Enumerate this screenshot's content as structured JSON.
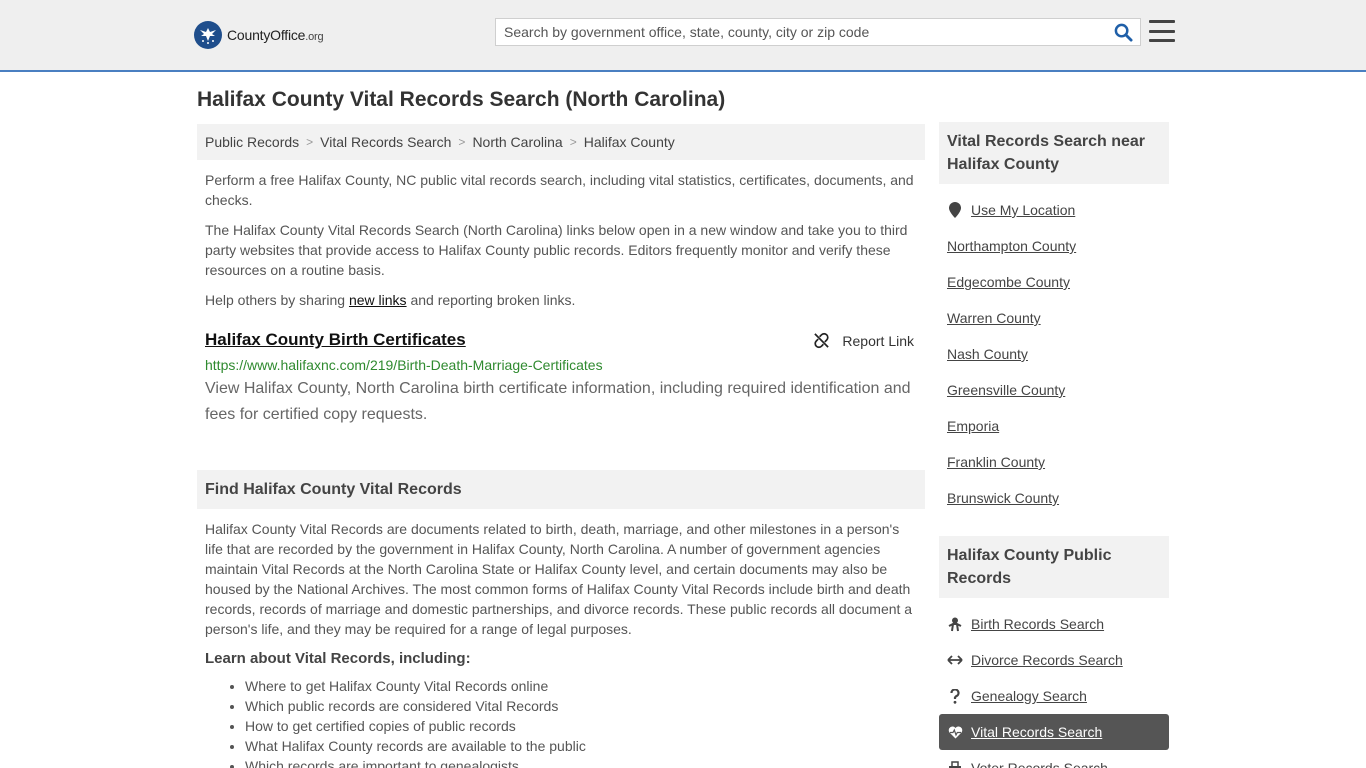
{
  "header": {
    "logo_main": "CountyOffice",
    "logo_tld": ".org",
    "search_placeholder": "Search by government office, state, county, city or zip code"
  },
  "page_title": "Halifax County Vital Records Search (North Carolina)",
  "breadcrumb": [
    "Public Records",
    "Vital Records Search",
    "North Carolina",
    "Halifax County"
  ],
  "intro": {
    "p1": "Perform a free Halifax County, NC public vital records search, including vital statistics, certificates, documents, and checks.",
    "p2": "The Halifax County Vital Records Search (North Carolina) links below open in a new window and take you to third party websites that provide access to Halifax County public records. Editors frequently monitor and verify these resources on a routine basis.",
    "p3_before": "Help others by sharing ",
    "p3_link": "new links",
    "p3_after": " and reporting broken links."
  },
  "result": {
    "title": "Halifax County Birth Certificates",
    "report_label": "Report Link",
    "url": "https://www.halifaxnc.com/219/Birth-Death-Marriage-Certificates",
    "description": "View Halifax County, North Carolina birth certificate information, including required identification and fees for certified copy requests."
  },
  "find_section": {
    "heading": "Find Halifax County Vital Records",
    "body": "Halifax County Vital Records are documents related to birth, death, marriage, and other milestones in a person's life that are recorded by the government in Halifax County, North Carolina. A number of government agencies maintain Vital Records at the North Carolina State or Halifax County level, and certain documents may also be housed by the National Archives. The most common forms of Halifax County Vital Records include birth and death records, records of marriage and domestic partnerships, and divorce records. These public records all document a person's life, and they may be required for a range of legal purposes.",
    "learn_heading": "Learn about Vital Records, including:",
    "learn_items": [
      "Where to get Halifax County Vital Records online",
      "Which public records are considered Vital Records",
      "How to get certified copies of public records",
      "What Halifax County records are available to the public",
      "Which records are important to genealogists"
    ]
  },
  "sidebar": {
    "nearby_heading": "Vital Records Search near Halifax County",
    "use_location": "Use My Location",
    "nearby": [
      "Northampton County",
      "Edgecombe County",
      "Warren County",
      "Nash County",
      "Greensville County",
      "Emporia",
      "Franklin County",
      "Brunswick County"
    ],
    "public_heading": "Halifax County Public Records",
    "public_records": [
      {
        "label": "Birth Records Search",
        "icon": "baby-icon"
      },
      {
        "label": "Divorce Records Search",
        "icon": "arrows-icon"
      },
      {
        "label": "Genealogy Search",
        "icon": "question-icon"
      },
      {
        "label": "Vital Records Search",
        "icon": "heartbeat-icon",
        "active": true
      },
      {
        "label": "Voter Records Search",
        "icon": "ballot-icon"
      }
    ]
  },
  "colors": {
    "accent": "#4a7fc1",
    "url_green": "#2f8a2f",
    "active_bg": "#555555",
    "logo_blue": "#1f4e8c"
  }
}
